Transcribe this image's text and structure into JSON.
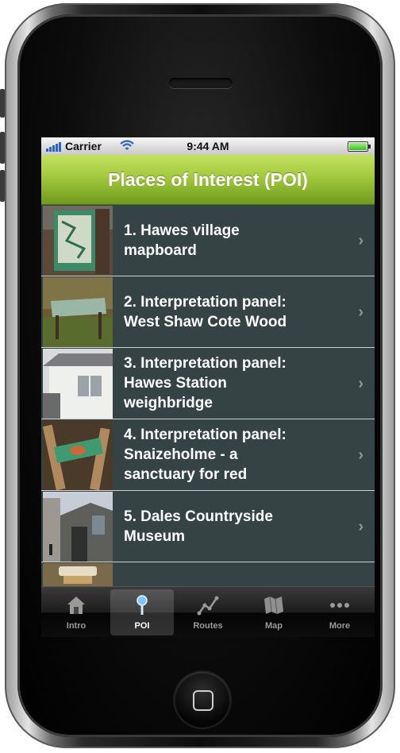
{
  "status_bar": {
    "carrier": "Carrier",
    "time": "9:44 AM"
  },
  "nav": {
    "title": "Places of Interest (POI)"
  },
  "poi_list": [
    {
      "label": "1. Hawes village\nmapboard"
    },
    {
      "label": "2. Interpretation panel:\nWest Shaw Cote Wood"
    },
    {
      "label": "3. Interpretation panel:\nHawes Station\nweighbridge"
    },
    {
      "label": "4. Interpretation panel:\nSnaizeholme - a\nsanctuary for red"
    },
    {
      "label": "5. Dales Countryside\nMuseum"
    }
  ],
  "tabs": [
    {
      "label": "Intro",
      "icon": "house-icon"
    },
    {
      "label": "POI",
      "icon": "pin-icon",
      "selected": true
    },
    {
      "label": "Routes",
      "icon": "route-icon"
    },
    {
      "label": "Map",
      "icon": "map-icon"
    },
    {
      "label": "More",
      "icon": "more-icon"
    }
  ],
  "colors": {
    "accent": "#a2c93d",
    "list_bg": "#354345",
    "separator": "#cdd3d3"
  }
}
